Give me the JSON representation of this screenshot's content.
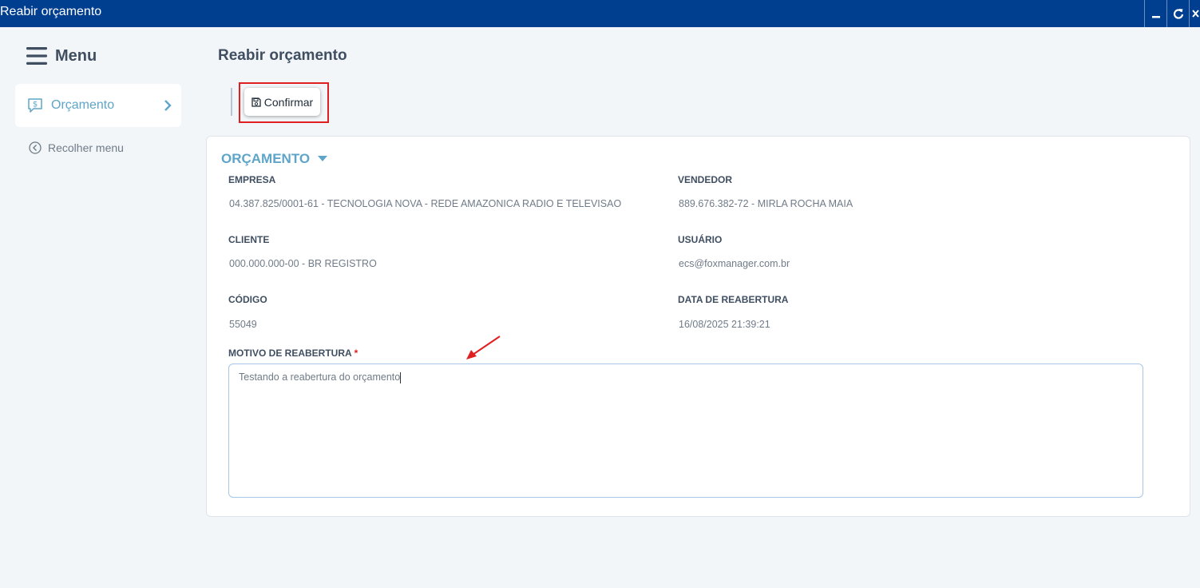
{
  "window": {
    "title": "Reabir orçamento",
    "controls": [
      "minimize-icon",
      "refresh-icon",
      "close-icon"
    ]
  },
  "sidebar": {
    "menu_label": "Menu",
    "items": [
      {
        "label": "Orçamento",
        "icon": "dollar-chat-icon"
      }
    ],
    "collapse_label": "Recolher menu"
  },
  "main": {
    "title": "Reabir orçamento",
    "toolbar": {
      "confirm_label": "Confirmar"
    },
    "section": {
      "title": "ORÇAMENTO",
      "fields": {
        "empresa": {
          "label": "EMPRESA",
          "value": "04.387.825/0001-61 - TECNOLOGIA NOVA - REDE AMAZONICA RADIO E TELEVISAO"
        },
        "vendedor": {
          "label": "VENDEDOR",
          "value": "889.676.382-72 - MIRLA ROCHA MAIA"
        },
        "cliente": {
          "label": "CLIENTE",
          "value": "000.000.000-00 - BR REGISTRO"
        },
        "usuario": {
          "label": "USUÁRIO",
          "value": "ecs@foxmanager.com.br"
        },
        "codigo": {
          "label": "CÓDIGO",
          "value": "55049"
        },
        "data_reabertura": {
          "label": "DATA DE REABERTURA",
          "value": "16/08/2025 21:39:21"
        },
        "motivo": {
          "label": "MOTIVO DE REABERTURA",
          "required_mark": "*",
          "value": "Testando a reabertura do orçamento"
        }
      }
    }
  },
  "colors": {
    "titlebar": "#003f8f",
    "accent": "#5ea5c9",
    "highlight": "#e02020"
  }
}
